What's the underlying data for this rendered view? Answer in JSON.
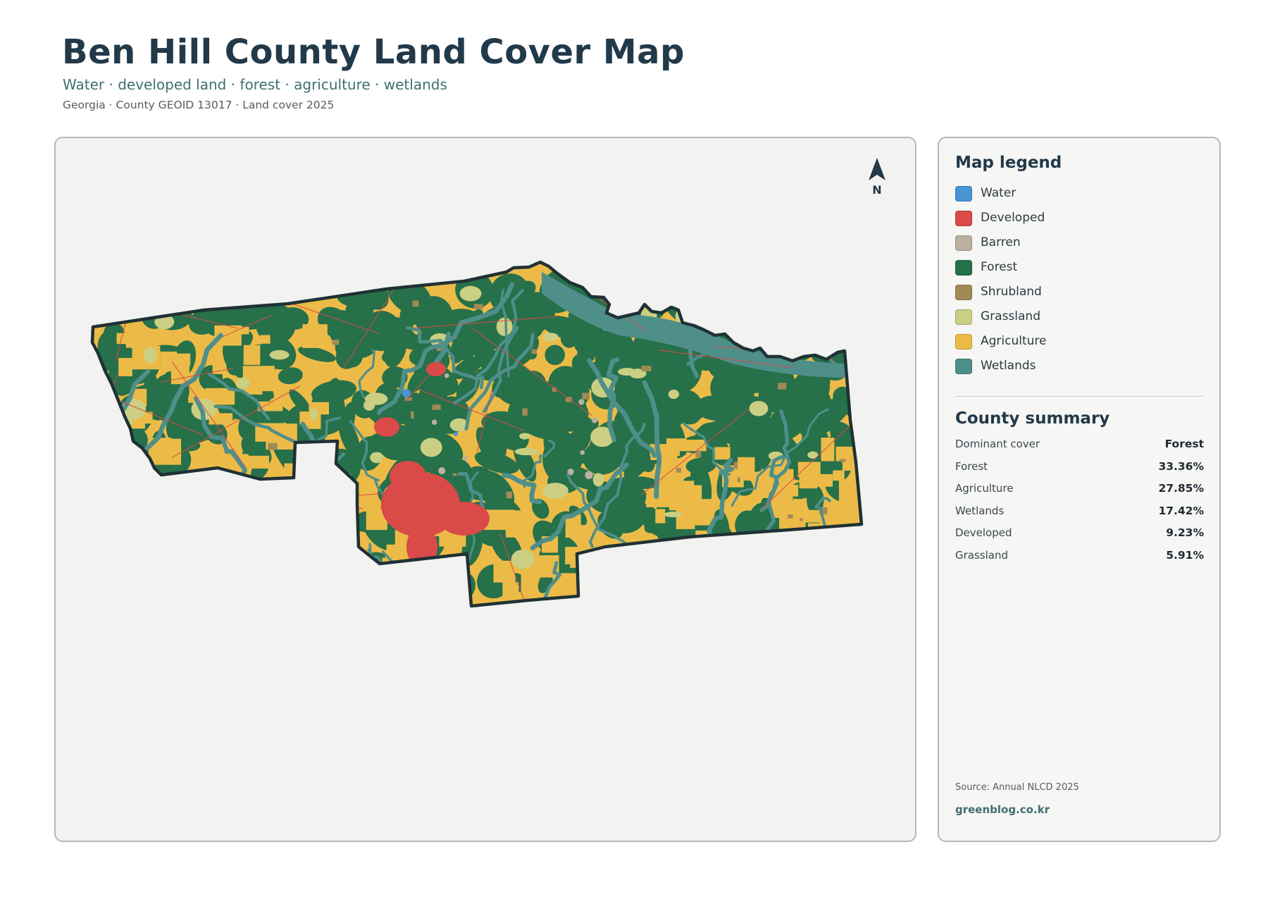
{
  "header": {
    "title": "Ben Hill County Land Cover Map",
    "subtitle": "Water · developed land · forest · agriculture · wetlands",
    "meta": "Georgia · County GEOID 13017 · Land cover 2025"
  },
  "map": {
    "north_label": "N",
    "colors": {
      "water": "#4a94d4",
      "developed": "#d94a48",
      "barren": "#bcb09e",
      "forest": "#26704a",
      "shrubland": "#a08a56",
      "grassland": "#cbcf83",
      "agriculture": "#ecbb47",
      "wetlands": "#4f8f8a",
      "outline": "#1f3135",
      "panel_bg": "#f2f2f1"
    }
  },
  "legend": {
    "title": "Map legend",
    "items": [
      {
        "label": "Water",
        "color": "#4a94d4"
      },
      {
        "label": "Developed",
        "color": "#d94a48"
      },
      {
        "label": "Barren",
        "color": "#bcb09e"
      },
      {
        "label": "Forest",
        "color": "#26704a"
      },
      {
        "label": "Shrubland",
        "color": "#a08a56"
      },
      {
        "label": "Grassland",
        "color": "#cbcf83"
      },
      {
        "label": "Agriculture",
        "color": "#ecbb47"
      },
      {
        "label": "Wetlands",
        "color": "#4f8f8a"
      }
    ]
  },
  "summary": {
    "title": "County summary",
    "rows": [
      {
        "key": "Dominant cover",
        "value": "Forest"
      },
      {
        "key": "Forest",
        "value": "33.36%"
      },
      {
        "key": "Agriculture",
        "value": "27.85%"
      },
      {
        "key": "Wetlands",
        "value": "17.42%"
      },
      {
        "key": "Developed",
        "value": "9.23%"
      },
      {
        "key": "Grassland",
        "value": "5.91%"
      }
    ]
  },
  "footer": {
    "source": "Source: Annual NLCD 2025",
    "credit": "greenblog.co.kr"
  }
}
